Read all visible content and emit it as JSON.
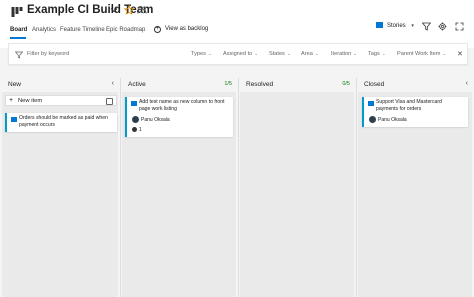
{
  "header": {
    "team_title": "Example CI Build Team",
    "view_backlog": "View as backlog",
    "stories": "Stories"
  },
  "tabs": [
    "Board",
    "Analytics",
    "Feature Timeline",
    "Epic Roadmap"
  ],
  "filters": {
    "placeholder": "Filter by keyword",
    "dropdowns": [
      "Types",
      "Assigned to",
      "States",
      "Area",
      "Iteration",
      "Tags",
      "Parent Work Item"
    ]
  },
  "columns": [
    {
      "name": "New",
      "count": "",
      "new_item": "New item",
      "cards": [
        {
          "title": "Orders should be marked as paid when payment occurs",
          "assignee": "",
          "tasks": ""
        }
      ]
    },
    {
      "name": "Active",
      "count": "1/5",
      "cards": [
        {
          "title": "Add test name as new column to front page work listing",
          "assignee": "Panu Oksala",
          "tasks": "1"
        }
      ]
    },
    {
      "name": "Resolved",
      "count": "0/5",
      "cards": []
    },
    {
      "name": "Closed",
      "count": "",
      "cards": [
        {
          "title": "Support Visa and Mastercard payments for orders",
          "assignee": "Panu Oksala",
          "tasks": ""
        }
      ]
    }
  ],
  "colors": {
    "accent": "#0078d4",
    "card_bar": "#009ccc",
    "count": "#107c10"
  }
}
